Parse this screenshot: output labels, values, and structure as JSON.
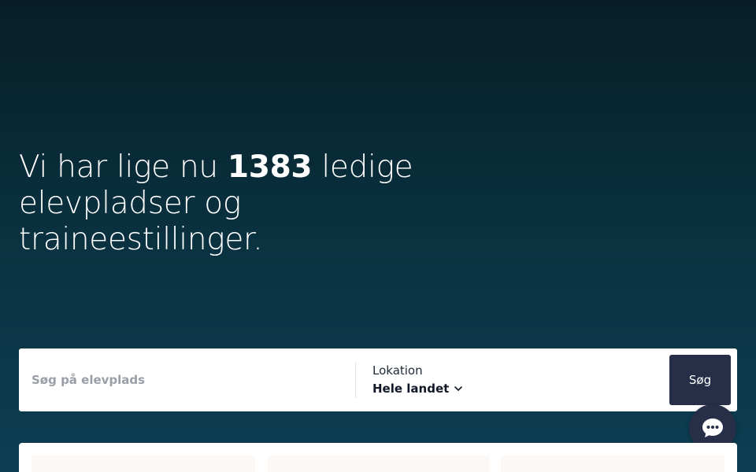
{
  "hero": {
    "prefix": "Vi har lige nu ",
    "count": "1383",
    "suffix": " ledige elevpladser og traineestillinger."
  },
  "search": {
    "placeholder": "Søg på elevplads",
    "location_label": "Lokation",
    "location_value": "Hele landet",
    "button_label": "Søg"
  },
  "icons": {
    "location_dropdown": "chevron-down-icon",
    "chat": "chat-bubble-icon"
  },
  "colors": {
    "background_top": "#071e27",
    "background_bottom": "#0c3e52",
    "button": "#262e48",
    "card": "#fcf8f5"
  }
}
